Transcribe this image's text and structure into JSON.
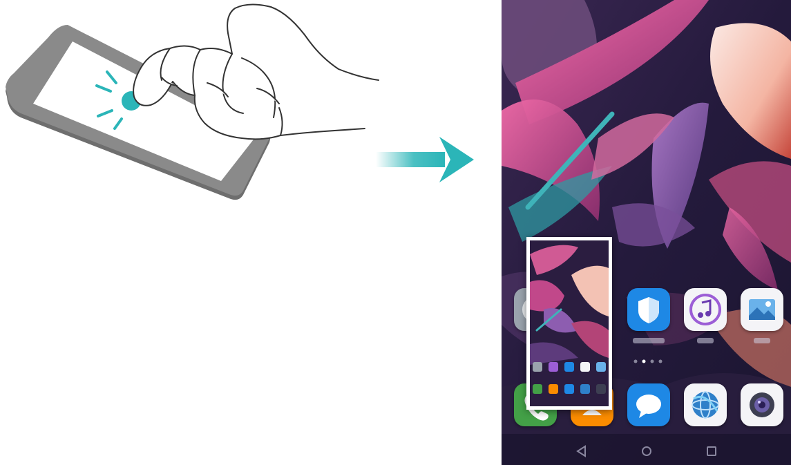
{
  "illustration": {
    "gesture": "knuckle-double-knock",
    "device": "phone",
    "tap_point_color": "#2bb5b8",
    "icon": "hand-knock-icon"
  },
  "arrow": {
    "icon": "right-arrow-icon",
    "color": "#2bb5b8"
  },
  "result_screen": {
    "content": "home-screen-with-screenshot-thumbnail",
    "apps_row_1": [
      "settings-icon",
      "phone-manager-icon",
      "music-icon",
      "gallery-icon"
    ],
    "apps_row_2": [
      "phone-icon",
      "contacts-icon",
      "messages-icon",
      "browser-icon",
      "camera-icon"
    ],
    "nav_buttons": [
      "back-icon",
      "home-icon",
      "recents-icon"
    ],
    "accent_colors": {
      "manager_blue": "#1e88e5",
      "messages_blue": "#1e88e5",
      "phone_green": "#43a047",
      "contacts_orange": "#fb8c00"
    }
  }
}
